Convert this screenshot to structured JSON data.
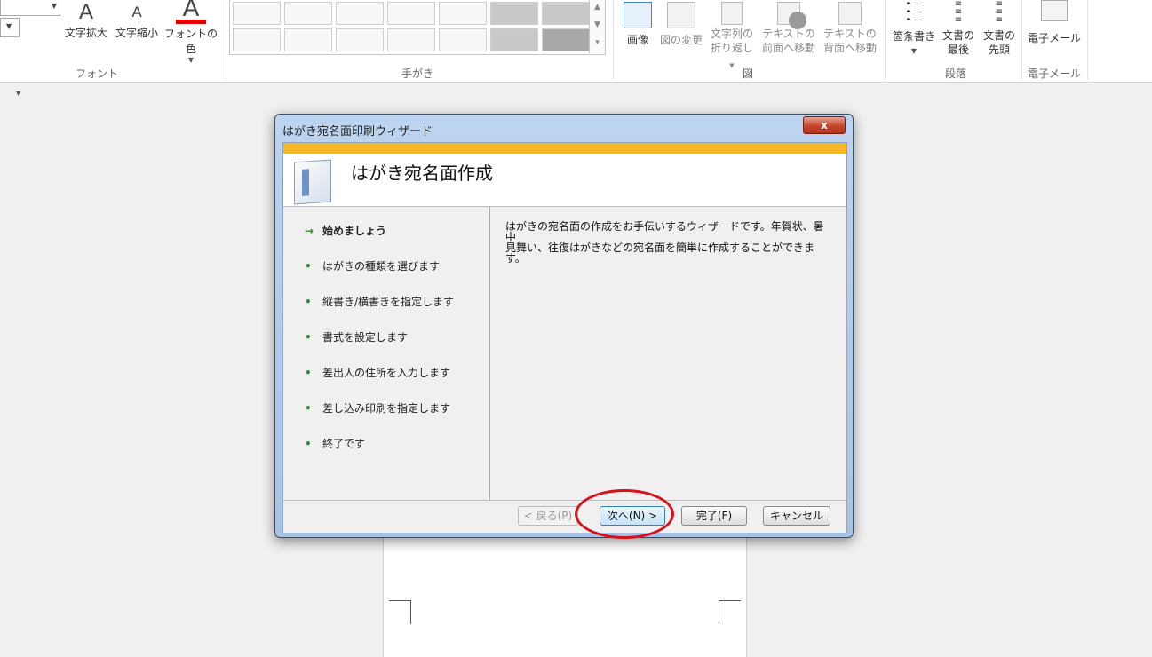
{
  "ribbon": {
    "font_group": {
      "grow_font": "文字拡大",
      "shrink_font": "文字縮小",
      "font_color": "フォントの色",
      "label": "フォント"
    },
    "handwriting_group": {
      "label": "手がき"
    },
    "figure_group": {
      "image": "画像",
      "change_image": "図の変更",
      "wrap_text_line1": "文字列の",
      "wrap_text_line2": "折り返し",
      "bring_front_line1": "テキストの",
      "bring_front_line2": "前面へ移動",
      "send_back_line1": "テキストの",
      "send_back_line2": "背面へ移動",
      "label": "図"
    },
    "paragraph_group": {
      "bullets": "箇条書き",
      "doc_end_line1": "文書の",
      "doc_end_line2": "最後",
      "doc_start_line1": "文書の",
      "doc_start_line2": "先頭",
      "label": "段落"
    },
    "email_group": {
      "email": "電子メール",
      "label": "電子メール"
    }
  },
  "dialog": {
    "title": "はがき宛名面印刷ウィザード",
    "close": "x",
    "banner_title": "はがき宛名面作成",
    "steps": [
      "始めましょう",
      "はがきの種類を選びます",
      "縦書き/横書きを指定します",
      "書式を設定します",
      "差出人の住所を入力します",
      "差し込み印刷を指定します",
      "終了です"
    ],
    "description_line1": "はがきの宛名面の作成をお手伝いするウィザードです。年賀状、暑中",
    "description_line2": "見舞い、往復はがきなどの宛名面を簡単に作成することができます。",
    "buttons": {
      "back": "< 戻る(P)",
      "next": "次へ(N) >",
      "finish": "完了(F)",
      "cancel": "キャンセル"
    }
  }
}
